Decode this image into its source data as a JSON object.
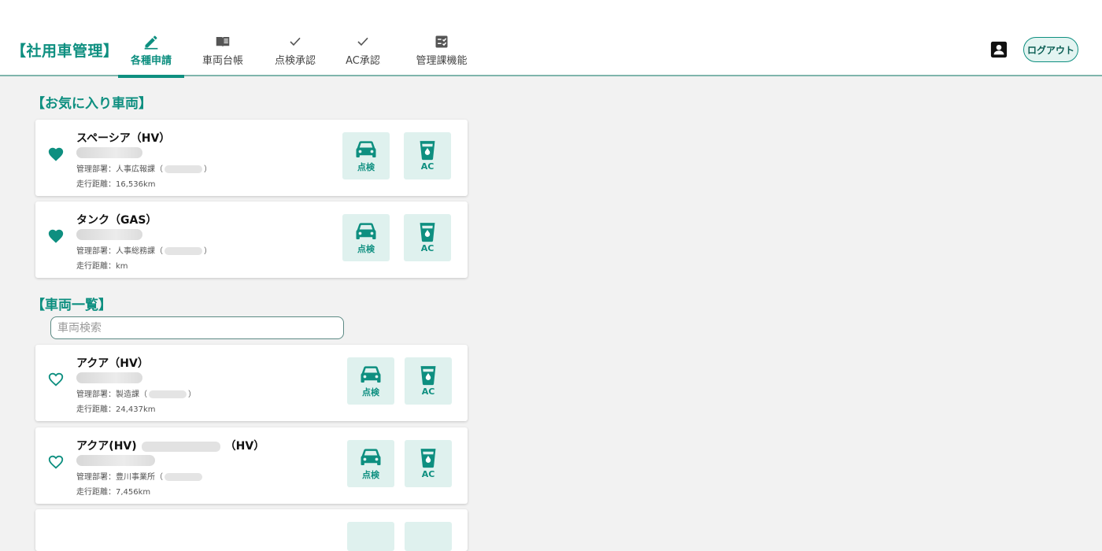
{
  "app": {
    "title": "【社用車管理】"
  },
  "nav": [
    {
      "label": "各種申請",
      "icon": "pencil-icon",
      "active": true
    },
    {
      "label": "車両台帳",
      "icon": "book-icon",
      "active": false
    },
    {
      "label": "点検承認",
      "icon": "check-icon",
      "active": false
    },
    {
      "label": "AC承認",
      "icon": "check-icon",
      "active": false
    },
    {
      "label": "管理課機能",
      "icon": "checklist-icon",
      "active": false
    }
  ],
  "header": {
    "account_icon": "account-box-icon",
    "logout_label": "ログアウト"
  },
  "favorites": {
    "title": "【お気に入り車両】",
    "items": [
      {
        "name": "スペーシア（HV）",
        "dept_prefix": "管理部署：人事広報課（",
        "dept_suffix": "）",
        "distance": "走行距離：16,536km",
        "favorite": true
      },
      {
        "name": "タンク（GAS）",
        "dept_prefix": "管理部署：人事総務課（",
        "dept_suffix": "）",
        "distance": "走行距離：km",
        "favorite": true
      }
    ]
  },
  "vehicles": {
    "title": "【車両一覧】",
    "search_placeholder": "車両検索",
    "items": [
      {
        "name": "アクア（HV）",
        "dept_prefix": "管理部署：製造課（",
        "dept_suffix": "）",
        "distance": "走行距離：24,437km",
        "favorite": false
      },
      {
        "name_prefix": "アクア(HV)",
        "name_suffix": "（HV）",
        "dept_prefix": "管理部署：豊川事業所（",
        "dept_suffix": "",
        "distance": "走行距離：7,456km",
        "favorite": false
      }
    ]
  },
  "actions": {
    "inspection_label": "点検",
    "ac_label": "AC"
  },
  "colors": {
    "accent": "#0e8f80",
    "action_bg": "#dff1ee",
    "background": "#f2f2f2"
  }
}
